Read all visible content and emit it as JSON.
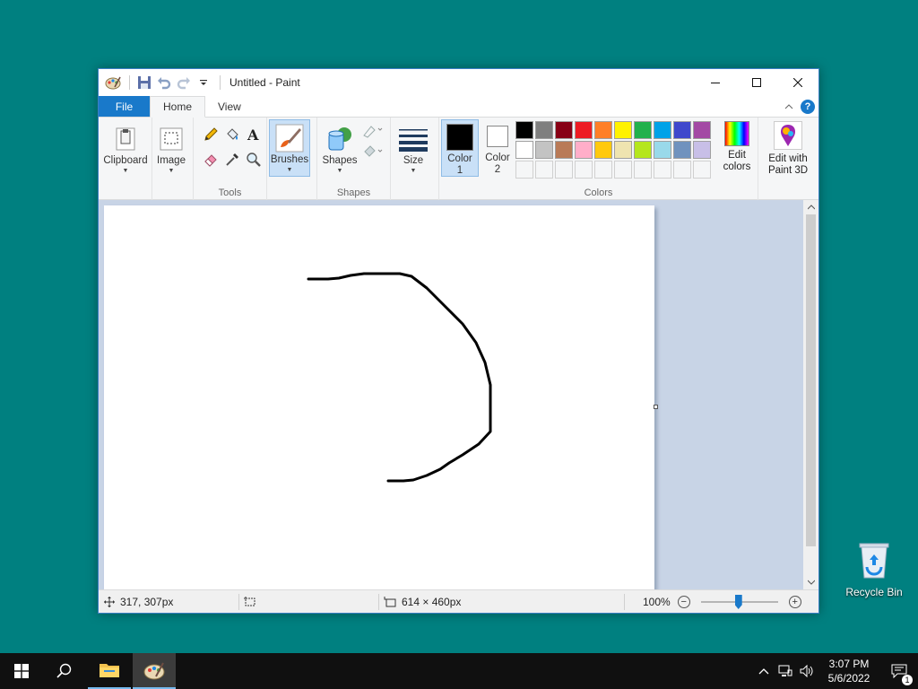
{
  "desktop": {
    "recycle_bin_label": "Recycle Bin"
  },
  "window": {
    "title": "Untitled - Paint",
    "controls": {
      "minimize": "minimize",
      "maximize": "maximize",
      "close": "close"
    }
  },
  "tabs": {
    "file": "File",
    "home": "Home",
    "view": "View"
  },
  "ribbon": {
    "clipboard_label": "Clipboard",
    "image_label": "Image",
    "tools_group": "Tools",
    "brushes_label": "Brushes",
    "shapes_label": "Shapes",
    "shapes_group": "Shapes",
    "size_label": "Size",
    "color1_label": "Color\n1",
    "color1_a": "Color",
    "color1_b": "1",
    "color2_a": "Color",
    "color2_b": "2",
    "colors_group": "Colors",
    "edit_colors_a": "Edit",
    "edit_colors_b": "colors",
    "paint3d_a": "Edit with",
    "paint3d_b": "Paint 3D",
    "color1_value": "#000000",
    "color2_value": "#ffffff",
    "palette": [
      "#000000",
      "#7f7f7f",
      "#880015",
      "#ed1c24",
      "#ff7f27",
      "#fff200",
      "#22b14c",
      "#00a2e8",
      "#3f48cc",
      "#a349a4",
      "#ffffff",
      "#c3c3c3",
      "#b97a57",
      "#ffaec9",
      "#ffc90e",
      "#efe4b0",
      "#b5e61d",
      "#99d9ea",
      "#7092be",
      "#c8bfe7"
    ],
    "custom_slots": 10
  },
  "status": {
    "cursor_pos": "317, 307px",
    "canvas_size": "614 × 460px",
    "zoom": "100%"
  },
  "taskbar": {
    "time": "3:07 PM",
    "date": "5/6/2022",
    "notification_count": "1"
  }
}
